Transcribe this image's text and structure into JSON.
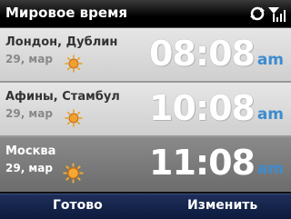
{
  "header": {
    "title": "Мировое время",
    "status_icons": [
      "sync-icon",
      "signal-icon"
    ]
  },
  "cities": [
    {
      "name": "Лондон, Дублин",
      "date": "29, мар",
      "time": "08:08",
      "ampm": "am",
      "icon": "sun-icon",
      "selected": false
    },
    {
      "name": "Афины, Стамбул",
      "date": "29, мар",
      "time": "10:08",
      "ampm": "am",
      "icon": "sun-icon",
      "selected": false
    },
    {
      "name": "Москва",
      "date": "29, мар",
      "time": "11:08",
      "ampm": "am",
      "icon": "sun-icon",
      "selected": true
    }
  ],
  "softkeys": {
    "left": "Готово",
    "right": "Изменить"
  },
  "colors": {
    "ampm": "#3d8ccf",
    "selected_row": "#7a7a7a",
    "row": "#dadada",
    "softbar": "#16244b"
  }
}
